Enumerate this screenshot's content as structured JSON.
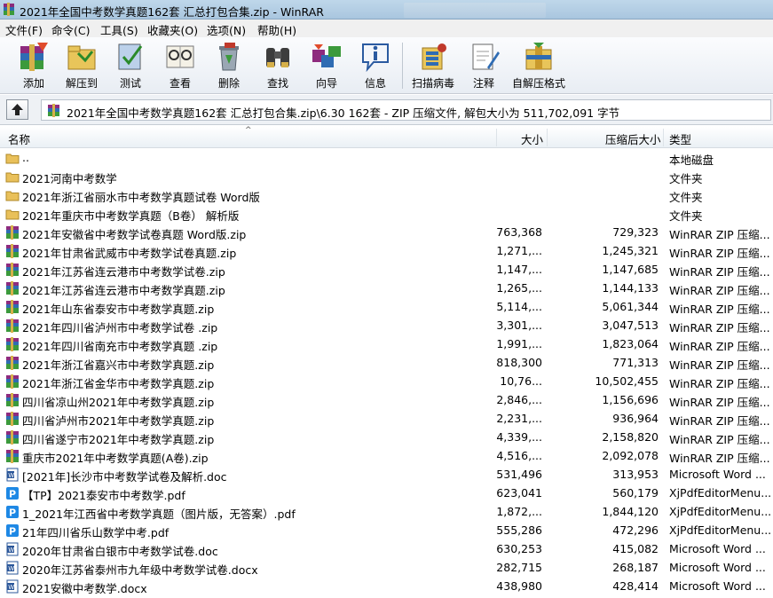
{
  "window": {
    "title": "2021年全国中考数学真题162套 汇总打包合集.zip - WinRAR"
  },
  "menu": [
    {
      "label": "文件(F)"
    },
    {
      "label": "命令(C)"
    },
    {
      "label": "工具(S)"
    },
    {
      "label": "收藏夹(O)"
    },
    {
      "label": "选项(N)"
    },
    {
      "label": "帮助(H)"
    }
  ],
  "toolbar": [
    {
      "label": "添加",
      "icon": "add-archive-icon"
    },
    {
      "label": "解压到",
      "icon": "extract-to-icon"
    },
    {
      "label": "测试",
      "icon": "test-icon"
    },
    {
      "label": "查看",
      "icon": "view-icon"
    },
    {
      "label": "删除",
      "icon": "delete-icon"
    },
    {
      "label": "查找",
      "icon": "find-icon"
    },
    {
      "label": "向导",
      "icon": "wizard-icon"
    },
    {
      "label": "信息",
      "icon": "info-icon"
    },
    {
      "label": "扫描病毒",
      "icon": "virus-scan-icon"
    },
    {
      "label": "注释",
      "icon": "comment-icon"
    },
    {
      "label": "自解压格式",
      "icon": "sfx-icon"
    }
  ],
  "address": {
    "text": "2021年全国中考数学真题162套 汇总打包合集.zip\\6.30   162套 - ZIP 压缩文件, 解包大小为 511,702,091 字节"
  },
  "columns": {
    "name": "名称",
    "size": "大小",
    "packed": "压缩后大小",
    "type": "类型"
  },
  "files": [
    {
      "name": "..",
      "size": "",
      "packed": "",
      "type": "本地磁盘",
      "icon": "folder-icon"
    },
    {
      "name": "2021河南中考数学",
      "size": "",
      "packed": "",
      "type": "文件夹",
      "icon": "folder-icon"
    },
    {
      "name": "2021年浙江省丽水市中考数学真题试卷  Word版",
      "size": "",
      "packed": "",
      "type": "文件夹",
      "icon": "folder-icon"
    },
    {
      "name": "2021年重庆市中考数学真题（B卷）   解析版",
      "size": "",
      "packed": "",
      "type": "文件夹",
      "icon": "folder-icon"
    },
    {
      "name": "2021年安徽省中考数学试卷真题  Word版.zip",
      "size": "763,368",
      "packed": "729,323",
      "type": "WinRAR ZIP 压缩...",
      "icon": "zip-icon"
    },
    {
      "name": "2021年甘肃省武威市中考数学试卷真题.zip",
      "size": "1,271,...",
      "packed": "1,245,321",
      "type": "WinRAR ZIP 压缩...",
      "icon": "zip-icon"
    },
    {
      "name": "2021年江苏省连云港市中考数学试卷.zip",
      "size": "1,147,...",
      "packed": "1,147,685",
      "type": "WinRAR ZIP 压缩...",
      "icon": "zip-icon"
    },
    {
      "name": "2021年江苏省连云港市中考数学真题.zip",
      "size": "1,265,...",
      "packed": "1,144,133",
      "type": "WinRAR ZIP 压缩...",
      "icon": "zip-icon"
    },
    {
      "name": "2021年山东省泰安市中考数学真题.zip",
      "size": "5,114,...",
      "packed": "5,061,344",
      "type": "WinRAR ZIP 压缩...",
      "icon": "zip-icon"
    },
    {
      "name": "2021年四川省泸州市中考数学试卷 .zip",
      "size": "3,301,...",
      "packed": "3,047,513",
      "type": "WinRAR ZIP 压缩...",
      "icon": "zip-icon"
    },
    {
      "name": "2021年四川省南充市中考数学真题 .zip",
      "size": "1,991,...",
      "packed": "1,823,064",
      "type": "WinRAR ZIP 压缩...",
      "icon": "zip-icon"
    },
    {
      "name": "2021年浙江省嘉兴市中考数学真题.zip",
      "size": "818,300",
      "packed": "771,313",
      "type": "WinRAR ZIP 压缩...",
      "icon": "zip-icon"
    },
    {
      "name": "2021年浙江省金华市中考数学真题.zip",
      "size": "10,76...",
      "packed": "10,502,455",
      "type": "WinRAR ZIP 压缩...",
      "icon": "zip-icon"
    },
    {
      "name": "四川省凉山州2021年中考数学真题.zip",
      "size": "2,846,...",
      "packed": "1,156,696",
      "type": "WinRAR ZIP 压缩...",
      "icon": "zip-icon"
    },
    {
      "name": "四川省泸州市2021年中考数学真题.zip",
      "size": "2,231,...",
      "packed": "936,964",
      "type": "WinRAR ZIP 压缩...",
      "icon": "zip-icon"
    },
    {
      "name": "四川省遂宁市2021年中考数学真题.zip",
      "size": "4,339,...",
      "packed": "2,158,820",
      "type": "WinRAR ZIP 压缩...",
      "icon": "zip-icon"
    },
    {
      "name": "重庆市2021年中考数学真题(A卷).zip",
      "size": "4,516,...",
      "packed": "2,092,078",
      "type": "WinRAR ZIP 压缩...",
      "icon": "zip-icon"
    },
    {
      "name": "[2021年]长沙市中考数学试卷及解析.doc",
      "size": "531,496",
      "packed": "313,953",
      "type": "Microsoft Word ...",
      "icon": "word-doc-icon"
    },
    {
      "name": "【TP】2021泰安市中考数学.pdf",
      "size": "623,041",
      "packed": "560,179",
      "type": "XjPdfEditorMenu...",
      "icon": "pdf-icon"
    },
    {
      "name": "1_2021年江西省中考数学真题（图片版，无答案）.pdf",
      "size": "1,872,...",
      "packed": "1,844,120",
      "type": "XjPdfEditorMenu...",
      "icon": "pdf-icon"
    },
    {
      "name": "21年四川省乐山数学中考.pdf",
      "size": "555,286",
      "packed": "472,296",
      "type": "XjPdfEditorMenu...",
      "icon": "pdf-icon"
    },
    {
      "name": "2020年甘肃省白银市中考数学试卷.doc",
      "size": "630,253",
      "packed": "415,082",
      "type": "Microsoft Word ...",
      "icon": "word-doc-icon"
    },
    {
      "name": "2020年江苏省泰州市九年级中考数学试卷.docx",
      "size": "282,715",
      "packed": "268,187",
      "type": "Microsoft Word ...",
      "icon": "word-doc-icon"
    },
    {
      "name": "2021安徽中考数学.docx",
      "size": "438,980",
      "packed": "428,414",
      "type": "Microsoft Word ...",
      "icon": "word-doc-icon"
    }
  ]
}
